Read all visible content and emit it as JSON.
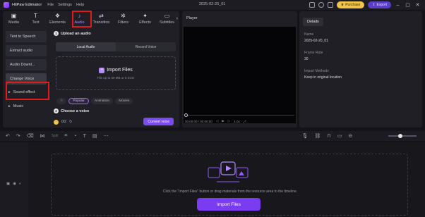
{
  "titlebar": {
    "app_name": "HitPaw Edimakor",
    "menus": [
      "File",
      "Settings",
      "Help"
    ],
    "project_date": "2025-02-20_01",
    "purchase_label": "Purchase",
    "export_label": "Export"
  },
  "tabs": [
    {
      "label": "Media",
      "icon": "folder-icon",
      "glyph": "▣"
    },
    {
      "label": "Text",
      "icon": "text-icon",
      "glyph": "T"
    },
    {
      "label": "Elements",
      "icon": "elements-icon",
      "glyph": "❖"
    },
    {
      "label": "Audio",
      "icon": "music-note-icon",
      "glyph": "♪"
    },
    {
      "label": "Transition",
      "icon": "transition-icon",
      "glyph": "⇄"
    },
    {
      "label": "Filters",
      "icon": "filters-icon",
      "glyph": "✲"
    },
    {
      "label": "Effects",
      "icon": "effects-icon",
      "glyph": "✦"
    },
    {
      "label": "Subtitles",
      "icon": "subtitles-icon",
      "glyph": "▭"
    }
  ],
  "sidebar": {
    "items": [
      "Text to Speech",
      "Extract audio",
      "Audio Downl...",
      "Change Voice"
    ],
    "groups": [
      "Sound effect",
      "Music"
    ]
  },
  "upload": {
    "step_label": "Upload an audio",
    "step_num": "1",
    "local_tab": "Local Audio",
    "record_tab": "Record Voice",
    "import_label": "Import Files",
    "hint": "File up to 50 MB or 5 mins"
  },
  "voice": {
    "step_label": "Choose a voice",
    "step_num": "2",
    "tabs": [
      "Popular",
      "Animation",
      "Movies"
    ],
    "credits": "0/2",
    "convert_label": "Convert voice"
  },
  "player": {
    "title": "Player",
    "time": "00:00:00 / 00:00:00",
    "speed": "1.0x"
  },
  "details": {
    "tab_label": "Details",
    "fields": [
      {
        "key": "Name",
        "value": "2025-02-20_01"
      },
      {
        "key": "Frame Rate",
        "value": "30"
      },
      {
        "key": "Import Methods",
        "value": "Keep in original location"
      }
    ]
  },
  "timeline": {
    "split_label": "Split",
    "drop_hint": "Click the \"Import Files\" button or drag materials from the resource area to the timeline.",
    "import_button": "Import Files"
  }
}
